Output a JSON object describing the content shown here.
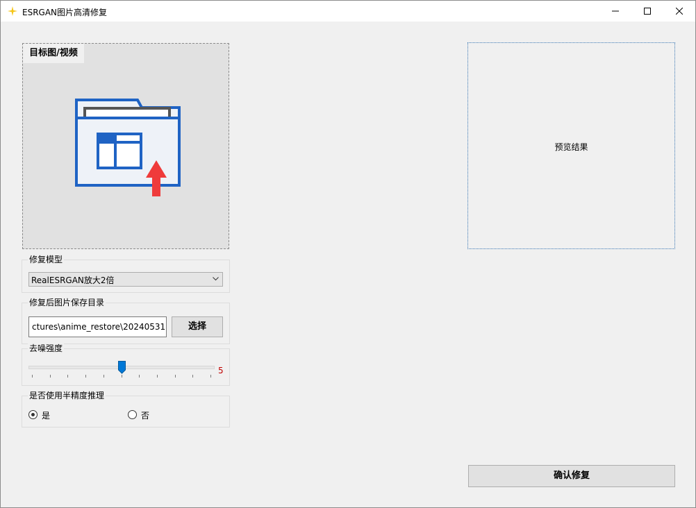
{
  "window": {
    "title": "ESRGAN图片高清修复",
    "icon": "sparkle-icon",
    "controls": [
      "minimize-icon",
      "maximize-icon",
      "close-icon"
    ]
  },
  "target": {
    "label": "目标图/视频",
    "icon": "folder-upload-icon"
  },
  "preview": {
    "text": "预览结果"
  },
  "model": {
    "title": "修复模型",
    "selected": "RealESRGAN放大2倍"
  },
  "save_dir": {
    "title": "修复后图片保存目录",
    "path": "ctures\\anime_restore\\20240531",
    "button": "选择"
  },
  "denoise": {
    "title": "去噪强度",
    "value": "5",
    "min": 0,
    "max": 10
  },
  "half_precision": {
    "title": "是否使用半精度推理",
    "options": [
      {
        "label": "是",
        "checked": true
      },
      {
        "label": "否",
        "checked": false
      }
    ]
  },
  "confirm": {
    "label": "确认修复"
  },
  "colors": {
    "accent": "#0078d7",
    "upload_arrow": "#ef3b3b",
    "folder_stroke": "#1f63c4",
    "slider_value": "#c00000"
  }
}
